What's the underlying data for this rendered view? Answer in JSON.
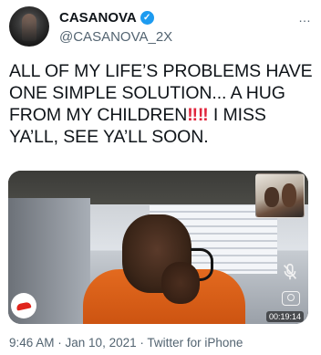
{
  "author": {
    "display_name": "CASANOVA",
    "handle": "@CASANOVA_2X",
    "verified": true
  },
  "more_menu": "…",
  "tweet": {
    "text_part1": "ALL OF MY LIFE’S PROBLEMS HAVE ONE SIMPLE SOLUTION... A HUG FROM MY CHILDREN",
    "emoji": "‼‼",
    "text_part2": " I MISS YA’LL, SEE YA’LL SOON."
  },
  "media": {
    "timer": "00:19:14"
  },
  "meta": {
    "time": "9:46 AM",
    "sep1": " · ",
    "date": "Jan 10, 2021",
    "sep2": " · ",
    "source": "Twitter for iPhone"
  },
  "colors": {
    "verified": "#1d9bf0",
    "end_call": "#e0241c",
    "shirt": "#e36a1f"
  }
}
